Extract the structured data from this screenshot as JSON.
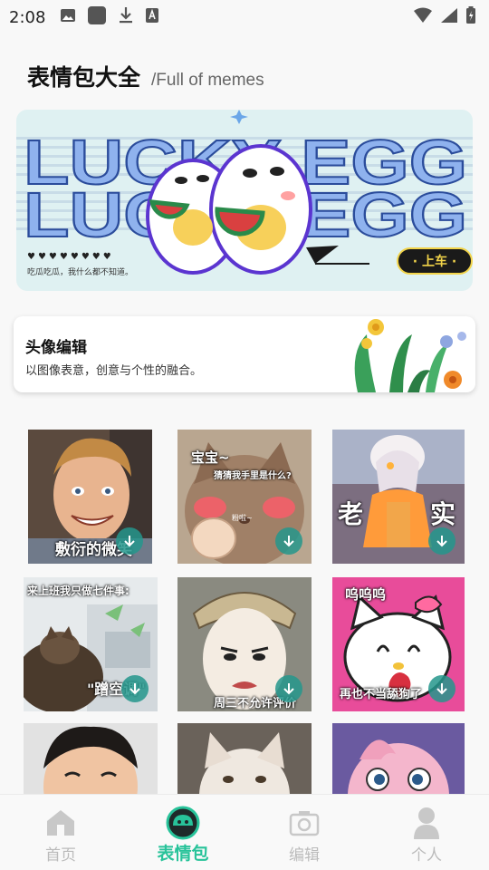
{
  "status_bar": {
    "time": "2:08",
    "left_icons": [
      "image-icon",
      "square-app-icon",
      "download-icon",
      "text-a-icon"
    ],
    "right_icons": [
      "wifi-icon",
      "cell-signal-icon",
      "battery-icon"
    ]
  },
  "header": {
    "title": "表情包大全",
    "subtitle": "/Full of memes"
  },
  "banner": {
    "headline": "LUCKY EGG",
    "caption": "吃瓜吃瓜，我什么都不知道。",
    "hearts": "♥♥♥♥♥♥♥♥",
    "board_button": "· 上车 ·",
    "colors": {
      "background": "#dff1f2",
      "headline": "#8fb2ee",
      "headline_outline": "#2b4c9b",
      "button_bg": "#1a1a1a",
      "button_text": "#f2d44a"
    }
  },
  "avatar_editor": {
    "title": "头像编辑",
    "description": "以图像表意，创意与个性的融合。"
  },
  "memes": [
    {
      "caption": "敷衍的微笑",
      "subject": "smiling-boy-photo"
    },
    {
      "caption": "宝宝~",
      "caption2": "猜猜我手里是什么?",
      "caption3": "粉啦~",
      "subject": "blushing-cat-photo"
    },
    {
      "caption": "老",
      "caption2": "实",
      "subject": "sky-child-character"
    },
    {
      "caption": "来上班我只做七件事:",
      "caption2": "\"蹭空调\"",
      "subject": "cat-at-office"
    },
    {
      "caption": "周三不允许评价",
      "subject": "opera-face"
    },
    {
      "caption": "呜呜呜",
      "caption2": "再也不当舔狗了",
      "subject": "crying-hello-kitty"
    },
    {
      "caption": "",
      "subject": "crying-kid-photo"
    },
    {
      "caption": "",
      "subject": "white-cat-photo"
    },
    {
      "caption": "",
      "subject": "jigglypuff"
    }
  ],
  "bottom_nav": [
    {
      "label": "首页",
      "icon": "home-icon",
      "active": false
    },
    {
      "label": "表情包",
      "icon": "emoji-face-icon",
      "active": true
    },
    {
      "label": "编辑",
      "icon": "camera-icon",
      "active": false
    },
    {
      "label": "个人",
      "icon": "person-icon",
      "active": false
    }
  ],
  "colors": {
    "accent": "#28c39a",
    "download_button": "#24968c",
    "inactive_nav": "#bbbbbb"
  }
}
